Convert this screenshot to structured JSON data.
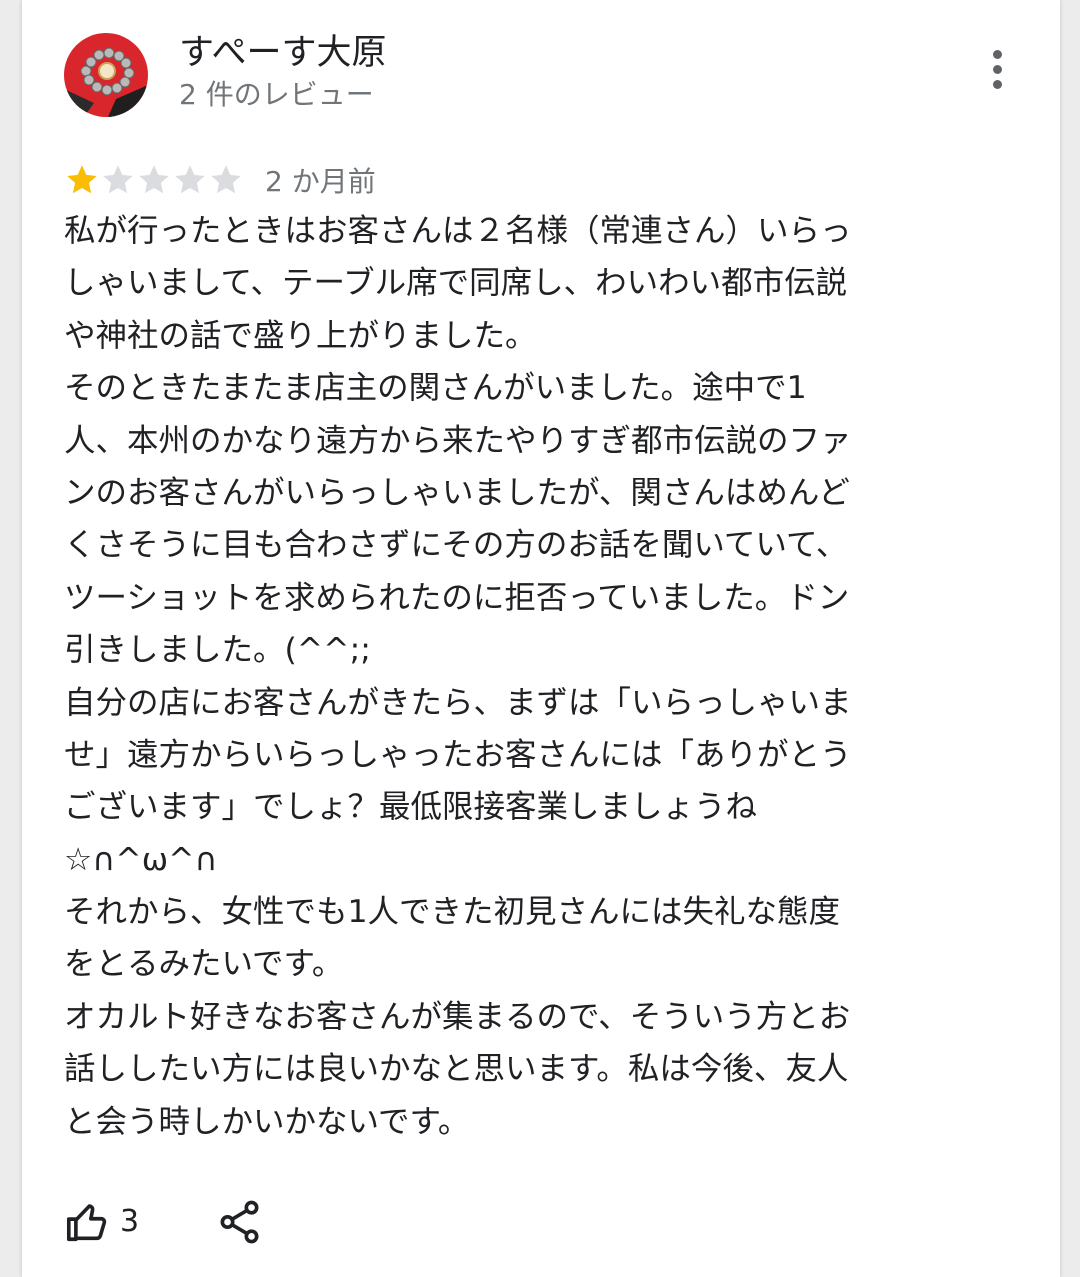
{
  "author": {
    "name": "すぺーす大原",
    "review_count": "2 件のレビュー"
  },
  "review": {
    "rating": 1,
    "rating_max": 5,
    "time_ago": "2 か月前",
    "lines": [
      "私が行ったときはお客さんは２名様（常連さん）いらっ",
      "しゃいまして、テーブル席で同席し、わいわい都市伝説",
      "や神社の話で盛り上がりました。",
      "そのときたまたま店主の関さんがいました。途中で1",
      "人、本州のかなり遠方から来たやりすぎ都市伝説のファ",
      "ンのお客さんがいらっしゃいましたが、関さんはめんど",
      "くさそうに目も合わさずにその方のお話を聞いていて、",
      "ツーショットを求められたのに拒否っていました。ドン",
      "引きしました。(^^;;",
      "自分の店にお客さんがきたら、まずは「いらっしゃいま",
      "せ」遠方からいらっしゃったお客さんには「ありがとう",
      "ございます」でしょ？最低限接客業しましょうね",
      "☆∩^ω^∩",
      "それから、女性でも1人できた初見さんには失礼な態度",
      "をとるみたいです。",
      "オカルト好きなお客さんが集まるので、そういう方とお",
      "話ししたい方には良いかなと思います。私は今後、友人",
      "と会う時しかいかないです。"
    ]
  },
  "actions": {
    "like_count": "3"
  },
  "icons": {
    "more": "more-vert-icon",
    "like": "thumb-up-icon",
    "share": "share-icon",
    "star": "star-icon"
  },
  "colors": {
    "star_filled": "#fbbc04",
    "star_empty": "#dadce0",
    "text_primary": "#202124",
    "text_secondary": "#70757a"
  }
}
